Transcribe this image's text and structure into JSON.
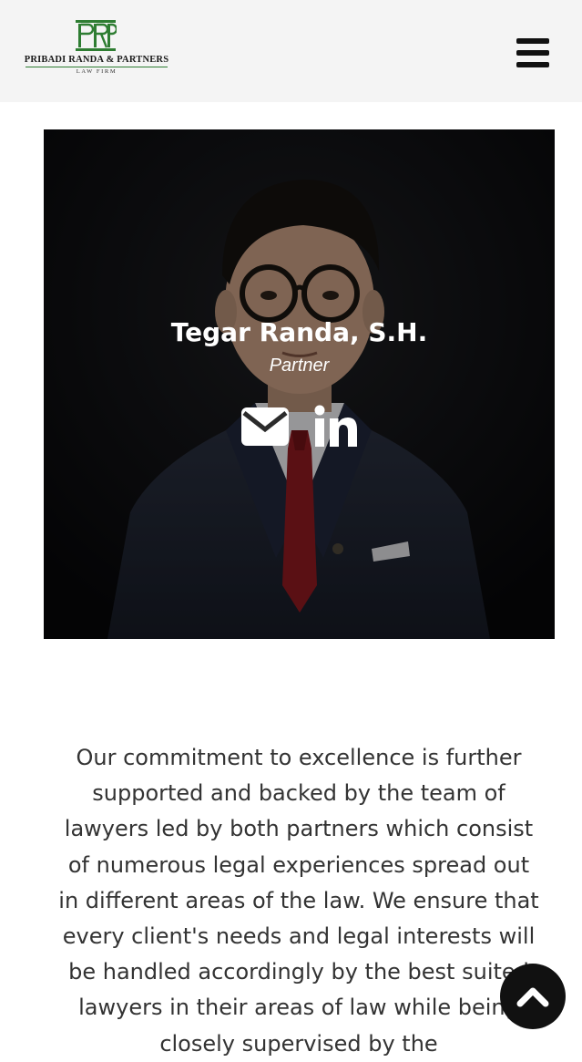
{
  "header": {
    "logo": {
      "firm_name": "PRIBADI RANDA & PARTNERS",
      "subtitle": "LAW FIRM",
      "monogram": "PRP",
      "brand_color": "#2e7d32"
    },
    "menu_icon": "hamburger-icon"
  },
  "profile": {
    "name": "Tegar Randa, S.H.",
    "role": "Partner",
    "icons": [
      "envelope-icon",
      "linkedin-icon"
    ],
    "overlay_color": "rgba(0,0,0,0.35)"
  },
  "intro": {
    "text": "Our commitment to excellence is further supported and backed by the team of lawyers led by both partners which consist of numerous legal experiences spread out in different areas of the law. We ensure that every client's needs and legal interests will be handled accordingly by the best suited lawyers in their areas of law while being closely supervised by the"
  },
  "scroll_top": {
    "icon": "chevron-up-icon",
    "color": "#111111"
  }
}
